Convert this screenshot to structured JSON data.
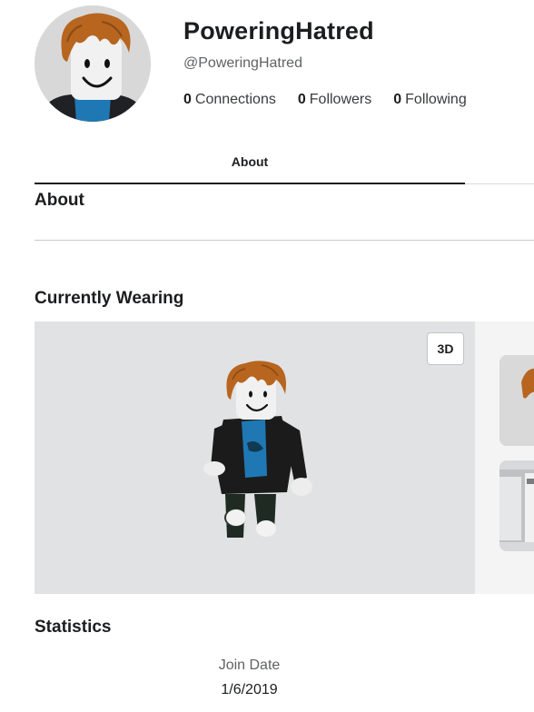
{
  "profile": {
    "display_name": "PoweringHatred",
    "username": "@PoweringHatred",
    "stats": [
      {
        "count": "0",
        "label": "Connections"
      },
      {
        "count": "0",
        "label": "Followers"
      },
      {
        "count": "0",
        "label": "Following"
      }
    ]
  },
  "tabs": [
    {
      "label": "About",
      "active": true
    }
  ],
  "about": {
    "title": "About"
  },
  "wearing": {
    "title": "Currently Wearing",
    "view_toggle_label": "3D"
  },
  "statistics": {
    "title": "Statistics",
    "join_date_label": "Join Date",
    "join_date_value": "1/6/2019"
  },
  "colors": {
    "text": "#1b1d1f",
    "muted": "#606264",
    "viewer_bg": "#e1e2e3",
    "hair": "#b7651f"
  }
}
